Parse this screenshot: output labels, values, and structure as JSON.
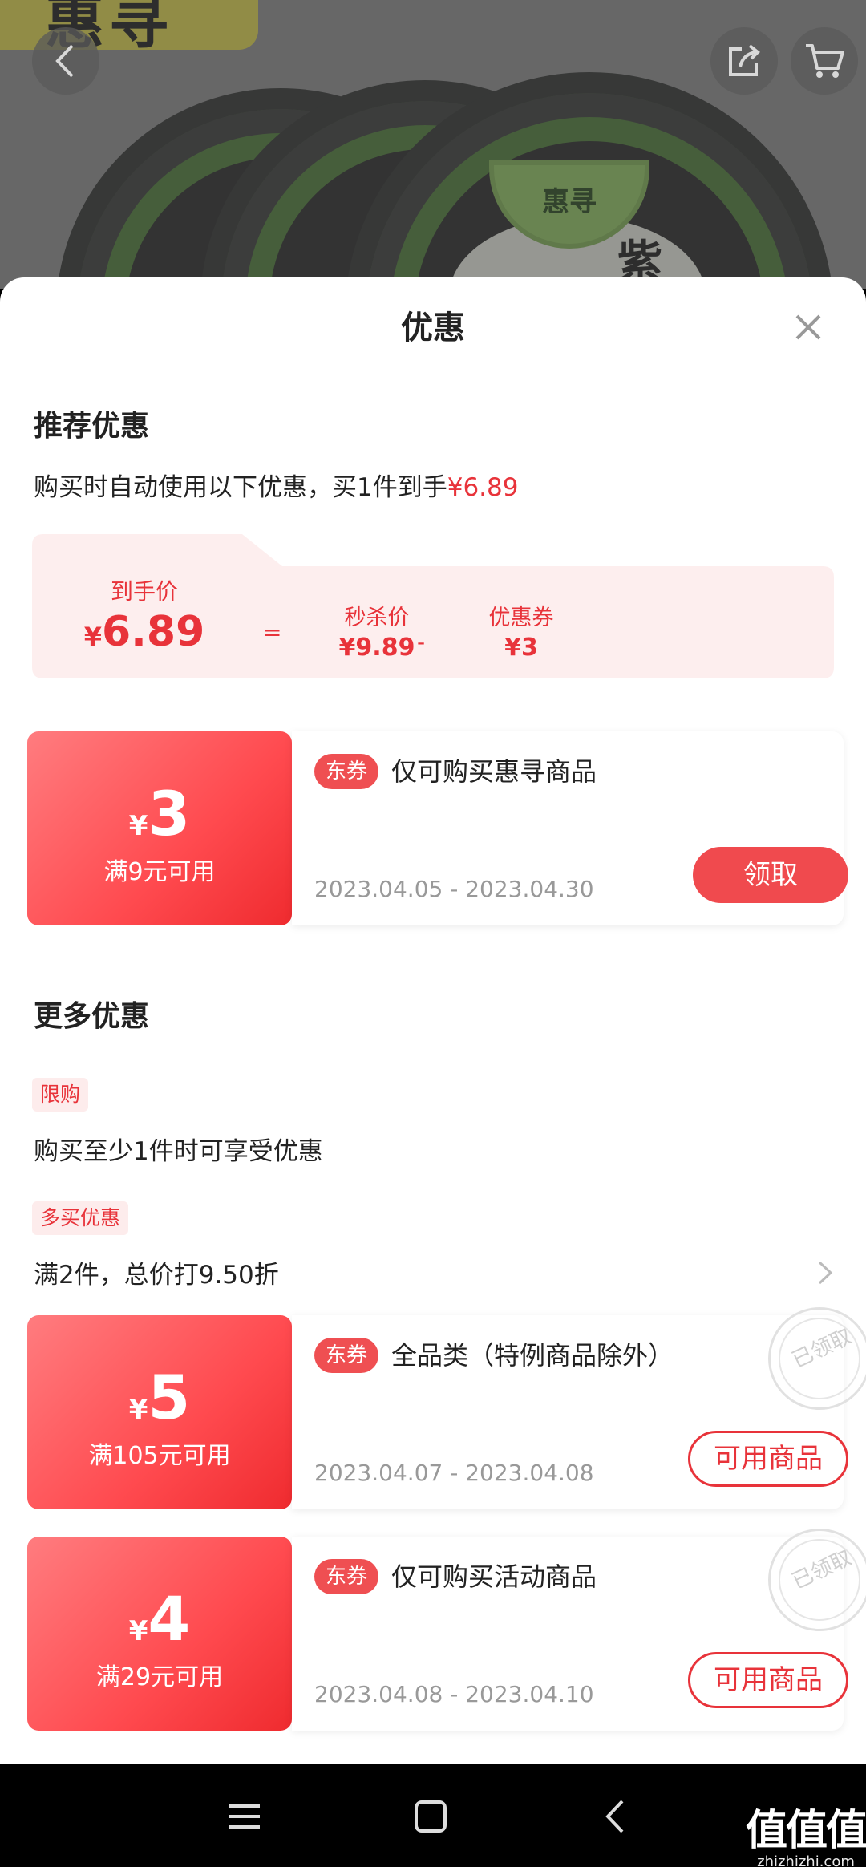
{
  "product": {
    "brand_text": "惠寻",
    "label_brand": "惠寻",
    "label_char": "紫"
  },
  "sheet": {
    "title": "优惠",
    "recommend": {
      "title": "推荐优惠",
      "desc_prefix": "购买时自动使用以下优惠，买1件到手",
      "desc_price": "¥6.89"
    },
    "breakdown": {
      "final_label": "到手价",
      "final_yen": "¥",
      "final_value": "6.89",
      "eq": "=",
      "flash_label": "秒杀价",
      "flash_value": "¥9.89",
      "minus": "-",
      "coupon_label": "优惠券",
      "coupon_value": "¥3"
    },
    "coupons": [
      {
        "yen": "¥",
        "amount": "3",
        "condition": "满9元可用",
        "tag": "东券",
        "desc": "仅可购买惠寻商品",
        "date": "2023.04.05 - 2023.04.30",
        "button": "领取",
        "claimed": false
      },
      {
        "yen": "¥",
        "amount": "5",
        "condition": "满105元可用",
        "tag": "东券",
        "desc": "全品类（特例商品除外）",
        "date": "2023.04.07 - 2023.04.08",
        "button": "可用商品",
        "claimed": true,
        "stamp": "已领取"
      },
      {
        "yen": "¥",
        "amount": "4",
        "condition": "满29元可用",
        "tag": "东券",
        "desc": "仅可购买活动商品",
        "date": "2023.04.08 - 2023.04.10",
        "button": "可用商品",
        "claimed": true,
        "stamp": "已领取"
      }
    ],
    "more": {
      "title": "更多优惠",
      "limit_chip": "限购",
      "limit_text": "购买至少1件时可享受优惠",
      "multi_chip": "多买优惠",
      "multi_text": "满2件，总价打9.50折"
    }
  },
  "watermark": {
    "main": "值值值",
    "sub": "zhizhizhi.com"
  },
  "colors": {
    "accent": "#e8333a",
    "coupon_gradient_start": "#ff7c7f",
    "coupon_gradient_end": "#ef2b2f",
    "price_box_bg": "#fdeeee"
  }
}
